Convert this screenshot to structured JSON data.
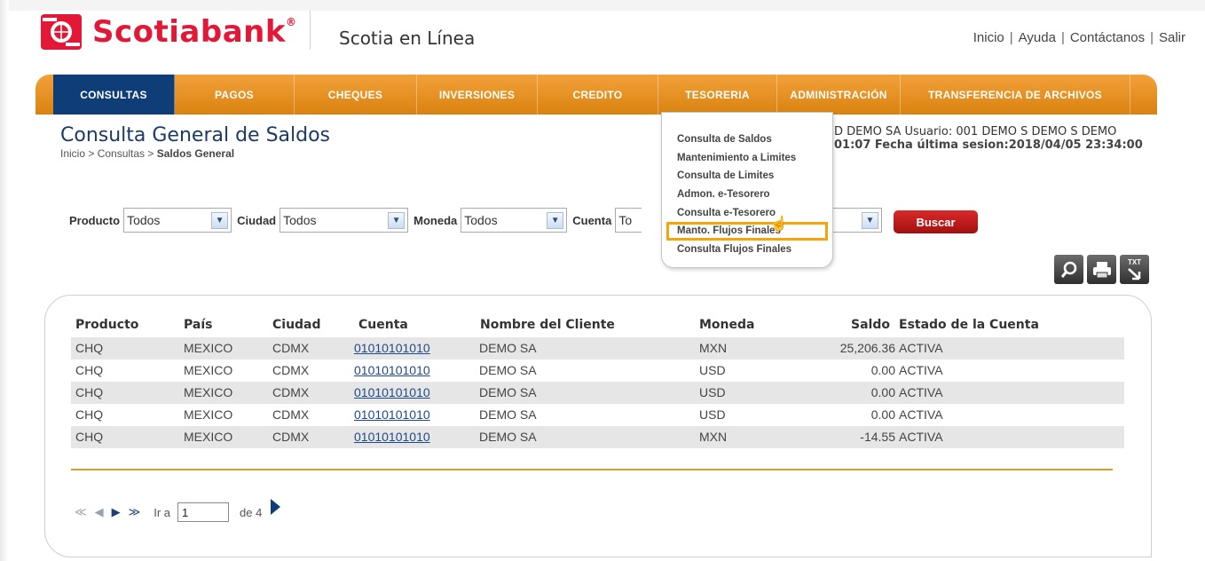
{
  "header": {
    "brand": "Scotiabank",
    "brand_reg": "®",
    "sub_brand": "Scotia en Línea",
    "links": [
      "Inicio",
      "Ayuda",
      "Contáctanos",
      "Salir"
    ],
    "link_sep": "|"
  },
  "nav": {
    "items": [
      "CONSULTAS",
      "PAGOS",
      "CHEQUES",
      "INVERSIONES",
      "CREDITO",
      "TESORERIA",
      "ADMINISTRACIÓN",
      "TRANSFERENCIA DE ARCHIVOS"
    ],
    "active": "CONSULTAS"
  },
  "page": {
    "title": "Consulta General de Saldos",
    "breadcrumb_prefix": "Inicio > Consultas > ",
    "breadcrumb_current": "Saldos General"
  },
  "user_info": {
    "line1": "D DEMO SA   Usuario: 001 DEMO S DEMO S DEMO",
    "line2": "01:07   Fecha última sesion:2018/04/05 23:34:00"
  },
  "filters": {
    "producto_label": "Producto",
    "producto_value": "Todos",
    "ciudad_label": "Ciudad",
    "ciudad_value": "Todos",
    "moneda_label": "Moneda",
    "moneda_value": "Todos",
    "cuenta_label": "Cuenta",
    "cuenta_value": "To",
    "search_button": "Buscar"
  },
  "dropdown": {
    "items": [
      "Consulta de Saldos",
      "Mantenimiento a Limites",
      "Consulta de Limites",
      "Admon. e-Tesorero",
      "Consulta e-Tesorero",
      "Manto. Flujos Finales",
      "Consulta Flujos Finales"
    ],
    "highlighted": "Manto. Flujos Finales"
  },
  "tools": [
    "search-icon",
    "print-icon",
    "txt-export-icon"
  ],
  "tools_txt_label": "TXT",
  "table": {
    "columns": [
      "Producto",
      "País",
      "Ciudad",
      "Cuenta",
      "Nombre del Cliente",
      "Moneda",
      "Saldo",
      "Estado de la Cuenta"
    ],
    "rows": [
      {
        "producto": "CHQ",
        "pais": "MEXICO",
        "ciudad": "CDMX",
        "cuenta": "01010101010",
        "cliente": "DEMO SA",
        "moneda": "MXN",
        "saldo": "25,206.36",
        "estado": "ACTIVA"
      },
      {
        "producto": "CHQ",
        "pais": "MEXICO",
        "ciudad": "CDMX",
        "cuenta": "01010101010",
        "cliente": "DEMO SA",
        "moneda": "USD",
        "saldo": "0.00",
        "estado": "ACTIVA"
      },
      {
        "producto": "CHQ",
        "pais": "MEXICO",
        "ciudad": "CDMX",
        "cuenta": "01010101010",
        "cliente": "DEMO SA",
        "moneda": "USD",
        "saldo": "0.00",
        "estado": "ACTIVA"
      },
      {
        "producto": "CHQ",
        "pais": "MEXICO",
        "ciudad": "CDMX",
        "cuenta": "01010101010",
        "cliente": "DEMO SA",
        "moneda": "USD",
        "saldo": "0.00",
        "estado": "ACTIVA"
      },
      {
        "producto": "CHQ",
        "pais": "MEXICO",
        "ciudad": "CDMX",
        "cuenta": "01010101010",
        "cliente": "DEMO SA",
        "moneda": "MXN",
        "saldo": "-14.55",
        "estado": "ACTIVA"
      }
    ]
  },
  "pager": {
    "goto_label": "Ir a",
    "page_value": "1",
    "of_label": "de 4"
  },
  "colors": {
    "brand_red": "#e31837",
    "nav_orange": "#e8921f",
    "nav_active": "#0e3d78",
    "title_blue": "#1c3a66",
    "highlight": "#f5a50a",
    "search_red": "#c01b1b"
  }
}
